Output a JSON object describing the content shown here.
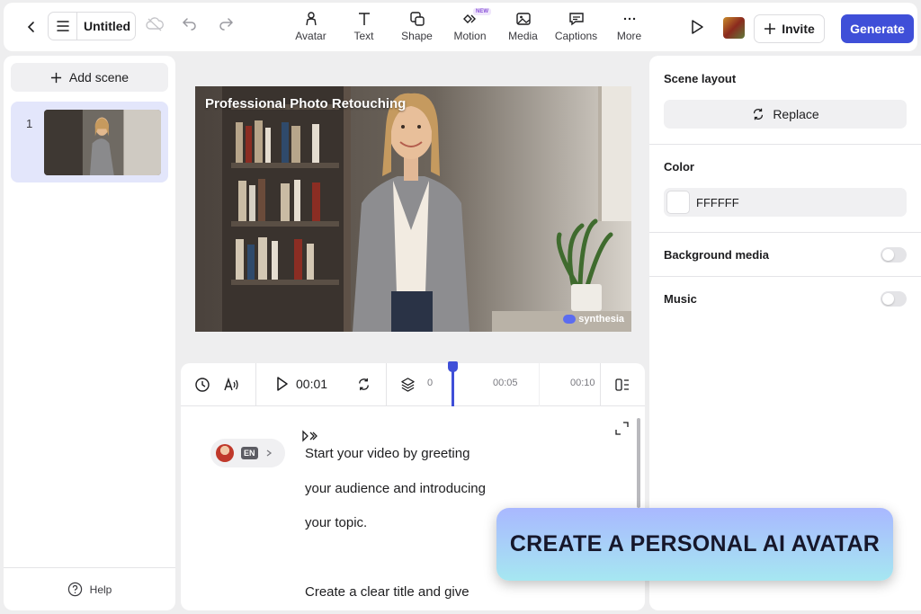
{
  "header": {
    "title": "Untitled",
    "tools": [
      {
        "label": "Avatar",
        "icon": "avatar-icon"
      },
      {
        "label": "Text",
        "icon": "text-icon"
      },
      {
        "label": "Shape",
        "icon": "shape-icon"
      },
      {
        "label": "Motion",
        "icon": "motion-icon",
        "badge": "NEW"
      },
      {
        "label": "Media",
        "icon": "media-icon"
      },
      {
        "label": "Captions",
        "icon": "captions-icon"
      },
      {
        "label": "More",
        "icon": "more-icon"
      }
    ],
    "invite_label": "Invite",
    "generate_label": "Generate"
  },
  "sidebar": {
    "add_scene_label": "Add scene",
    "scenes": [
      {
        "number": "1"
      }
    ],
    "help_label": "Help"
  },
  "preview": {
    "title": "Professional Photo Retouching",
    "watermark": "synthesia"
  },
  "timeline": {
    "current_time": "00:01",
    "ticks": [
      "0",
      "00:05",
      "00:10"
    ]
  },
  "script": {
    "language": "EN",
    "lines": [
      "Start your video by greeting",
      "your audience and introducing",
      "your topic.",
      "Create a clear title and give"
    ]
  },
  "properties": {
    "scene_layout_label": "Scene layout",
    "replace_label": "Replace",
    "color_label": "Color",
    "color_value": "FFFFFF",
    "background_media_label": "Background media",
    "music_label": "Music"
  },
  "promo": {
    "text": "CREATE A PERSONAL AI AVATAR"
  },
  "colors": {
    "accent": "#3f4fd8",
    "promo_top": "#a9b8ff",
    "promo_bottom": "#a6e7f1"
  }
}
